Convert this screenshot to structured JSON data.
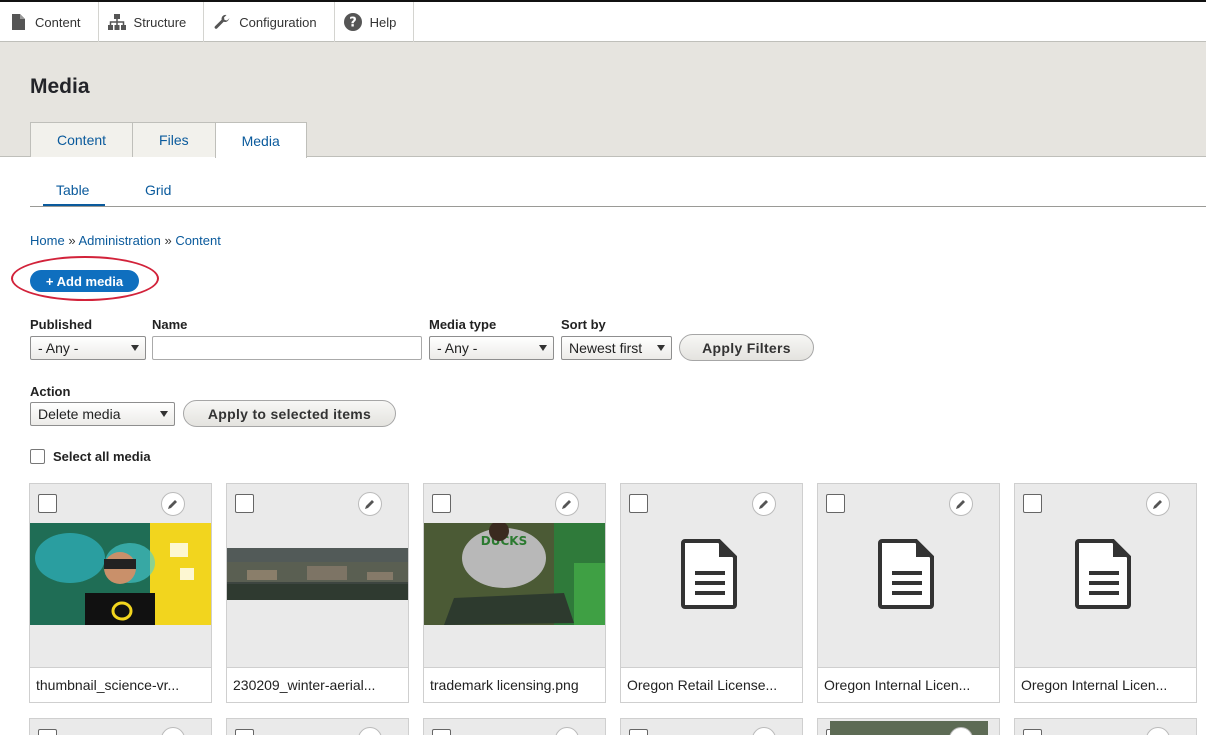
{
  "toolbar": {
    "items": [
      {
        "label": "Content",
        "icon": "page-icon"
      },
      {
        "label": "Structure",
        "icon": "sitemap-icon"
      },
      {
        "label": "Configuration",
        "icon": "wrench-icon"
      },
      {
        "label": "Help",
        "icon": "help-icon"
      }
    ]
  },
  "header": {
    "title": "Media",
    "tabs": [
      {
        "label": "Content",
        "active": false
      },
      {
        "label": "Files",
        "active": false
      },
      {
        "label": "Media",
        "active": true
      }
    ]
  },
  "subtabs": [
    {
      "label": "Table",
      "active": true
    },
    {
      "label": "Grid",
      "active": false
    }
  ],
  "breadcrumb": {
    "items": [
      "Home",
      "Administration",
      "Content"
    ],
    "separator": "»"
  },
  "add_media_label": "+ Add media",
  "filters": {
    "published": {
      "label": "Published",
      "value": "- Any -"
    },
    "name": {
      "label": "Name",
      "value": ""
    },
    "media_type": {
      "label": "Media type",
      "value": "- Any -"
    },
    "sort_by": {
      "label": "Sort by",
      "value": "Newest first"
    },
    "apply_label": "Apply Filters"
  },
  "bulk": {
    "action_label": "Action",
    "action_value": "Delete media",
    "apply_label": "Apply to selected items",
    "select_all_label": "Select all media"
  },
  "media_items": [
    {
      "name": "thumbnail_science-vr...",
      "kind": "image"
    },
    {
      "name": "230209_winter-aerial...",
      "kind": "image"
    },
    {
      "name": "trademark licensing.png",
      "kind": "image"
    },
    {
      "name": "Oregon Retail License...",
      "kind": "document"
    },
    {
      "name": "Oregon Internal Licen...",
      "kind": "document"
    },
    {
      "name": "Oregon Internal Licen...",
      "kind": "document"
    }
  ],
  "colors": {
    "accent": "#0f6fbf",
    "link": "#0a5a9c",
    "highlight_circle": "#d2223a",
    "header_bg": "#e6e4df"
  }
}
